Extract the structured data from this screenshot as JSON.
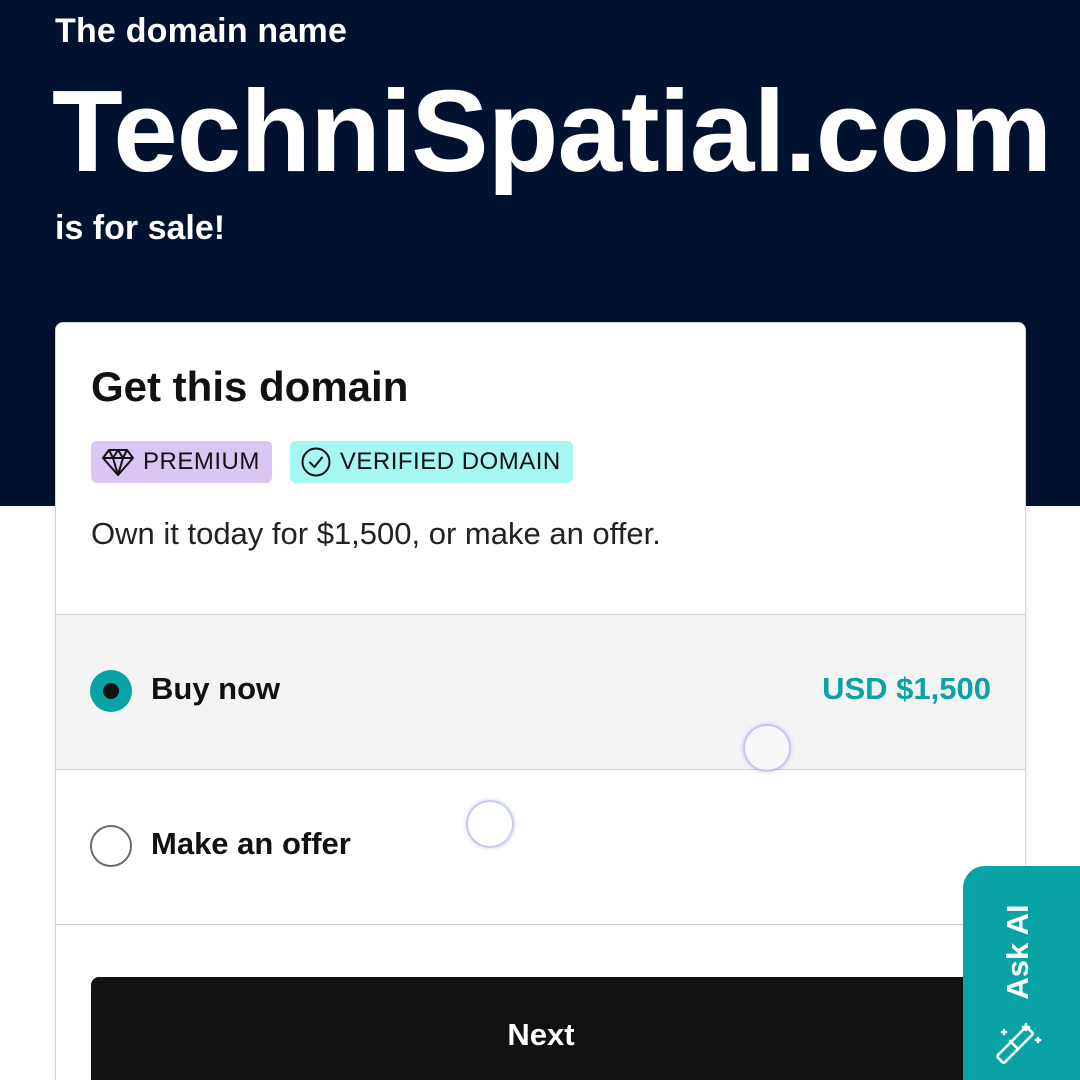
{
  "hero": {
    "eyebrow": "The domain name",
    "domain": "TechniSpatial.com",
    "subtitle": "is for sale!"
  },
  "card": {
    "title": "Get this domain",
    "badges": [
      {
        "label": "PREMIUM",
        "icon": "diamond-icon",
        "color": "#d9c6f5"
      },
      {
        "label": "VERIFIED DOMAIN",
        "icon": "check-circle-icon",
        "color": "#a6f6f2"
      }
    ],
    "description": "Own it today for $1,500, or make an offer.",
    "options": [
      {
        "label": "Buy now",
        "price": "USD $1,500",
        "selected": true
      },
      {
        "label": "Make an offer",
        "selected": false
      }
    ],
    "next_label": "Next"
  },
  "ask_ai": {
    "label": "Ask AI",
    "icon": "magic-wand-icon"
  },
  "colors": {
    "hero_bg": "#001230",
    "accent": "#09a3a5",
    "button_bg": "#111111"
  }
}
